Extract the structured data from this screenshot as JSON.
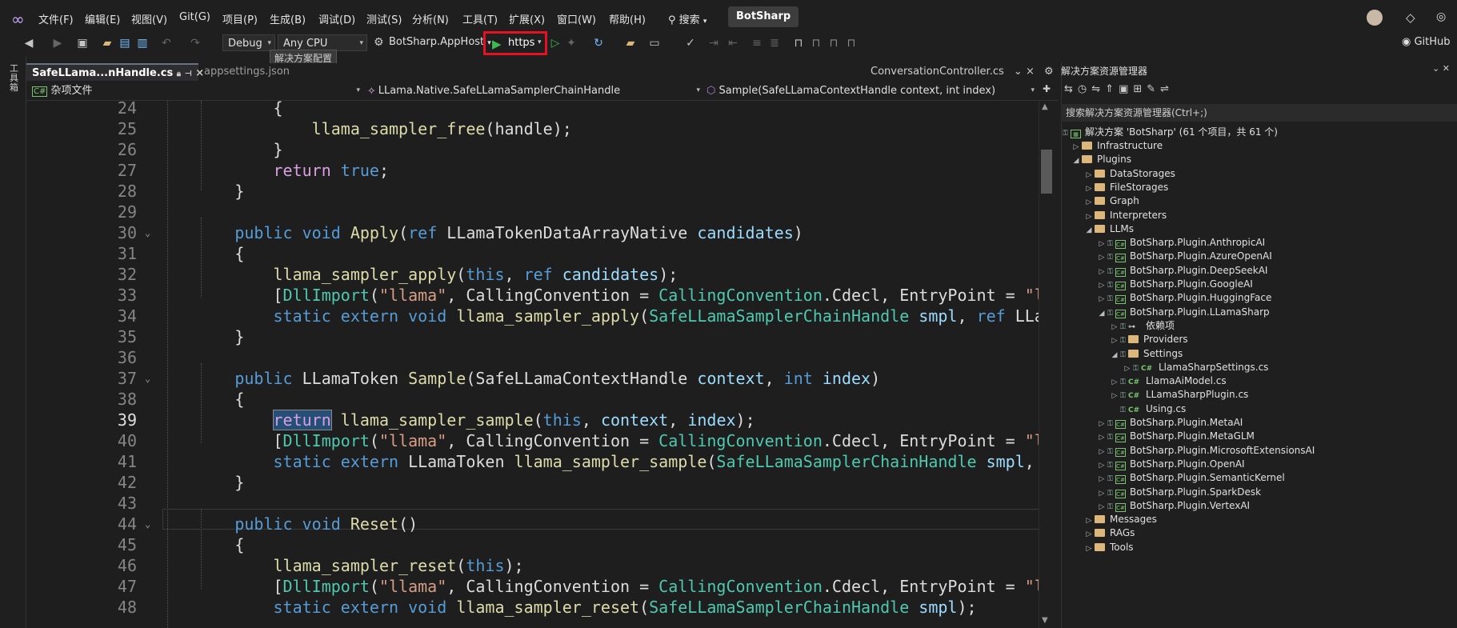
{
  "menu": {
    "items": [
      "文件(F)",
      "编辑(E)",
      "视图(V)",
      "Git(G)",
      "项目(P)",
      "生成(B)",
      "调试(D)",
      "测试(S)",
      "分析(N)",
      "工具(T)",
      "扩展(X)",
      "窗口(W)",
      "帮助(H)"
    ],
    "search_label": "搜索",
    "solution_name": "BotSharp",
    "github_label": "GitHub"
  },
  "toolbar": {
    "config": "Debug",
    "platform": "Any CPU",
    "startup_project": "BotSharp.AppHost",
    "run_profile": "https",
    "tooltip": "解决方案配置"
  },
  "left_strip": {
    "toolbox_label": "工具箱"
  },
  "tabs": {
    "active": "SafeLLama...nHandle.cs",
    "second": "appsettings.json",
    "right": "ConversationController.cs"
  },
  "navbar": {
    "project": "杂项文件",
    "type": "LLama.Native.SafeLLamaSamplerChainHandle",
    "member": "Sample(SafeLLamaContextHandle context, int index)"
  },
  "editor": {
    "current_line": 39,
    "lines": [
      {
        "n": "24",
        "tokens": [
          {
            "t": "            {",
            "c": "pl"
          }
        ]
      },
      {
        "n": "25",
        "tokens": [
          {
            "t": "                ",
            "c": "pl"
          },
          {
            "t": "llama_sampler_free",
            "c": "fn"
          },
          {
            "t": "(handle);",
            "c": "pl"
          }
        ]
      },
      {
        "n": "26",
        "tokens": [
          {
            "t": "            }",
            "c": "pl"
          }
        ]
      },
      {
        "n": "27",
        "tokens": [
          {
            "t": "            ",
            "c": "pl"
          },
          {
            "t": "return",
            "c": "ctl"
          },
          {
            "t": " ",
            "c": "pl"
          },
          {
            "t": "true",
            "c": "kw"
          },
          {
            "t": ";",
            "c": "pl"
          }
        ]
      },
      {
        "n": "28",
        "tokens": [
          {
            "t": "        }",
            "c": "pl"
          }
        ]
      },
      {
        "n": "29",
        "tokens": []
      },
      {
        "n": "30",
        "tokens": [
          {
            "t": "        ",
            "c": "pl"
          },
          {
            "t": "public",
            "c": "kw"
          },
          {
            "t": " ",
            "c": "pl"
          },
          {
            "t": "void",
            "c": "kw"
          },
          {
            "t": " ",
            "c": "pl"
          },
          {
            "t": "Apply",
            "c": "fn"
          },
          {
            "t": "(",
            "c": "pl"
          },
          {
            "t": "ref",
            "c": "kw"
          },
          {
            "t": " LLamaTokenDataArrayNative ",
            "c": "pl"
          },
          {
            "t": "candidates",
            "c": "prm"
          },
          {
            "t": ")",
            "c": "pl"
          }
        ]
      },
      {
        "n": "31",
        "tokens": [
          {
            "t": "        {",
            "c": "pl"
          }
        ]
      },
      {
        "n": "32",
        "tokens": [
          {
            "t": "            ",
            "c": "pl"
          },
          {
            "t": "llama_sampler_apply",
            "c": "fn"
          },
          {
            "t": "(",
            "c": "pl"
          },
          {
            "t": "this",
            "c": "kw"
          },
          {
            "t": ", ",
            "c": "pl"
          },
          {
            "t": "ref",
            "c": "kw"
          },
          {
            "t": " ",
            "c": "pl"
          },
          {
            "t": "candidates",
            "c": "prm"
          },
          {
            "t": ");",
            "c": "pl"
          }
        ]
      },
      {
        "n": "33",
        "tokens": [
          {
            "t": "            [",
            "c": "pl"
          },
          {
            "t": "DllImport",
            "c": "ty"
          },
          {
            "t": "(",
            "c": "pl"
          },
          {
            "t": "\"llama\"",
            "c": "str"
          },
          {
            "t": ", CallingConvention = ",
            "c": "pl"
          },
          {
            "t": "CallingConvention",
            "c": "ty"
          },
          {
            "t": ".",
            "c": "pl"
          },
          {
            "t": "Cdecl",
            "c": "pl"
          },
          {
            "t": ", EntryPoint = ",
            "c": "pl"
          },
          {
            "t": "\"llam",
            "c": "str"
          }
        ]
      },
      {
        "n": "34",
        "tokens": [
          {
            "t": "            ",
            "c": "pl"
          },
          {
            "t": "static",
            "c": "kw"
          },
          {
            "t": " ",
            "c": "pl"
          },
          {
            "t": "extern",
            "c": "kw"
          },
          {
            "t": " ",
            "c": "pl"
          },
          {
            "t": "void",
            "c": "kw"
          },
          {
            "t": " ",
            "c": "pl"
          },
          {
            "t": "llama_sampler_apply",
            "c": "fn"
          },
          {
            "t": "(",
            "c": "pl"
          },
          {
            "t": "SafeLLamaSamplerChainHandle",
            "c": "ty"
          },
          {
            "t": " ",
            "c": "pl"
          },
          {
            "t": "smpl",
            "c": "prm"
          },
          {
            "t": ", ",
            "c": "pl"
          },
          {
            "t": "ref",
            "c": "kw"
          },
          {
            "t": " LLamaT",
            "c": "pl"
          }
        ]
      },
      {
        "n": "35",
        "tokens": [
          {
            "t": "        }",
            "c": "pl"
          }
        ]
      },
      {
        "n": "36",
        "tokens": []
      },
      {
        "n": "37",
        "tokens": [
          {
            "t": "        ",
            "c": "pl"
          },
          {
            "t": "public",
            "c": "kw"
          },
          {
            "t": " LLamaToken ",
            "c": "pl"
          },
          {
            "t": "Sample",
            "c": "fn"
          },
          {
            "t": "(SafeLLamaContextHandle ",
            "c": "pl"
          },
          {
            "t": "context",
            "c": "prm"
          },
          {
            "t": ", ",
            "c": "pl"
          },
          {
            "t": "int",
            "c": "kw"
          },
          {
            "t": " ",
            "c": "pl"
          },
          {
            "t": "index",
            "c": "prm"
          },
          {
            "t": ")",
            "c": "pl"
          }
        ]
      },
      {
        "n": "38",
        "tokens": [
          {
            "t": "        {",
            "c": "pl"
          }
        ]
      },
      {
        "n": "39",
        "tokens": [
          {
            "t": "            ",
            "c": "pl"
          },
          {
            "t": "return",
            "c": "ctl"
          },
          {
            "t": " ",
            "c": "pl"
          },
          {
            "t": "llama_sampler_sample",
            "c": "fn"
          },
          {
            "t": "(",
            "c": "pl"
          },
          {
            "t": "this",
            "c": "kw"
          },
          {
            "t": ", ",
            "c": "pl"
          },
          {
            "t": "context",
            "c": "prm"
          },
          {
            "t": ", ",
            "c": "pl"
          },
          {
            "t": "index",
            "c": "prm"
          },
          {
            "t": ");",
            "c": "pl"
          }
        ]
      },
      {
        "n": "40",
        "tokens": [
          {
            "t": "            [",
            "c": "pl"
          },
          {
            "t": "DllImport",
            "c": "ty"
          },
          {
            "t": "(",
            "c": "pl"
          },
          {
            "t": "\"llama\"",
            "c": "str"
          },
          {
            "t": ", CallingConvention = ",
            "c": "pl"
          },
          {
            "t": "CallingConvention",
            "c": "ty"
          },
          {
            "t": ".",
            "c": "pl"
          },
          {
            "t": "Cdecl",
            "c": "pl"
          },
          {
            "t": ", EntryPoint = ",
            "c": "pl"
          },
          {
            "t": "\"llam",
            "c": "str"
          }
        ]
      },
      {
        "n": "41",
        "tokens": [
          {
            "t": "            ",
            "c": "pl"
          },
          {
            "t": "static",
            "c": "kw"
          },
          {
            "t": " ",
            "c": "pl"
          },
          {
            "t": "extern",
            "c": "kw"
          },
          {
            "t": " LLamaToken ",
            "c": "pl"
          },
          {
            "t": "llama_sampler_sample",
            "c": "fn"
          },
          {
            "t": "(",
            "c": "pl"
          },
          {
            "t": "SafeLLamaSamplerChainHandle",
            "c": "ty"
          },
          {
            "t": " ",
            "c": "pl"
          },
          {
            "t": "smpl",
            "c": "prm"
          },
          {
            "t": ", Saf",
            "c": "pl"
          }
        ]
      },
      {
        "n": "42",
        "tokens": [
          {
            "t": "        }",
            "c": "pl"
          }
        ]
      },
      {
        "n": "43",
        "tokens": []
      },
      {
        "n": "44",
        "tokens": [
          {
            "t": "        ",
            "c": "pl"
          },
          {
            "t": "public",
            "c": "kw"
          },
          {
            "t": " ",
            "c": "pl"
          },
          {
            "t": "void",
            "c": "kw"
          },
          {
            "t": " ",
            "c": "pl"
          },
          {
            "t": "Reset",
            "c": "fn"
          },
          {
            "t": "()",
            "c": "pl"
          }
        ]
      },
      {
        "n": "45",
        "tokens": [
          {
            "t": "        {",
            "c": "pl"
          }
        ]
      },
      {
        "n": "46",
        "tokens": [
          {
            "t": "            ",
            "c": "pl"
          },
          {
            "t": "llama_sampler_reset",
            "c": "fn"
          },
          {
            "t": "(",
            "c": "pl"
          },
          {
            "t": "this",
            "c": "kw"
          },
          {
            "t": ");",
            "c": "pl"
          }
        ]
      },
      {
        "n": "47",
        "tokens": [
          {
            "t": "            [",
            "c": "pl"
          },
          {
            "t": "DllImport",
            "c": "ty"
          },
          {
            "t": "(",
            "c": "pl"
          },
          {
            "t": "\"llama\"",
            "c": "str"
          },
          {
            "t": ", CallingConvention = ",
            "c": "pl"
          },
          {
            "t": "CallingConvention",
            "c": "ty"
          },
          {
            "t": ".",
            "c": "pl"
          },
          {
            "t": "Cdecl",
            "c": "pl"
          },
          {
            "t": ", EntryPoint = ",
            "c": "pl"
          },
          {
            "t": "\"llam",
            "c": "str"
          }
        ]
      },
      {
        "n": "48",
        "tokens": [
          {
            "t": "            ",
            "c": "pl"
          },
          {
            "t": "static",
            "c": "kw"
          },
          {
            "t": " ",
            "c": "pl"
          },
          {
            "t": "extern",
            "c": "kw"
          },
          {
            "t": " ",
            "c": "pl"
          },
          {
            "t": "void",
            "c": "kw"
          },
          {
            "t": " ",
            "c": "pl"
          },
          {
            "t": "llama_sampler_reset",
            "c": "fn"
          },
          {
            "t": "(",
            "c": "pl"
          },
          {
            "t": "SafeLLamaSamplerChainHandle",
            "c": "ty"
          },
          {
            "t": " ",
            "c": "pl"
          },
          {
            "t": "smpl",
            "c": "prm"
          },
          {
            "t": ");",
            "c": "pl"
          }
        ]
      }
    ]
  },
  "solution_explorer": {
    "title": "解决方案资源管理器",
    "search_placeholder": "搜索解决方案资源管理器(Ctrl+;)",
    "solution_label": "解决方案 'BotSharp' (61 个项目，共 61 个)",
    "items": [
      {
        "label": "Infrastructure",
        "kind": "folder",
        "depth": 0,
        "tw": "▷"
      },
      {
        "label": "Plugins",
        "kind": "folder",
        "depth": 0,
        "tw": "◢"
      },
      {
        "label": "DataStorages",
        "kind": "folder",
        "depth": 1,
        "tw": "▷"
      },
      {
        "label": "FileStorages",
        "kind": "folder",
        "depth": 1,
        "tw": "▷"
      },
      {
        "label": "Graph",
        "kind": "folder",
        "depth": 1,
        "tw": "▷"
      },
      {
        "label": "Interpreters",
        "kind": "folder",
        "depth": 1,
        "tw": "▷"
      },
      {
        "label": "LLMs",
        "kind": "folder",
        "depth": 1,
        "tw": "◢"
      },
      {
        "label": "BotSharp.Plugin.AnthropicAI",
        "kind": "project",
        "depth": 2,
        "tw": "▷"
      },
      {
        "label": "BotSharp.Plugin.AzureOpenAI",
        "kind": "project",
        "depth": 2,
        "tw": "▷"
      },
      {
        "label": "BotSharp.Plugin.DeepSeekAI",
        "kind": "project",
        "depth": 2,
        "tw": "▷"
      },
      {
        "label": "BotSharp.Plugin.GoogleAI",
        "kind": "project",
        "depth": 2,
        "tw": "▷"
      },
      {
        "label": "BotSharp.Plugin.HuggingFace",
        "kind": "project",
        "depth": 2,
        "tw": "▷"
      },
      {
        "label": "BotSharp.Plugin.LLamaSharp",
        "kind": "project",
        "depth": 2,
        "tw": "◢"
      },
      {
        "label": "依赖项",
        "kind": "deps",
        "depth": 3,
        "tw": "▷"
      },
      {
        "label": "Providers",
        "kind": "folder",
        "depth": 3,
        "tw": "▷"
      },
      {
        "label": "Settings",
        "kind": "folder",
        "depth": 3,
        "tw": "◢"
      },
      {
        "label": "LlamaSharpSettings.cs",
        "kind": "cs",
        "depth": 4,
        "tw": "▷"
      },
      {
        "label": "LlamaAiModel.cs",
        "kind": "cs",
        "depth": 3,
        "tw": "▷"
      },
      {
        "label": "LLamaSharpPlugin.cs",
        "kind": "cs",
        "depth": 3,
        "tw": "▷"
      },
      {
        "label": "Using.cs",
        "kind": "cs",
        "depth": 3,
        "tw": ""
      },
      {
        "label": "BotSharp.Plugin.MetaAI",
        "kind": "project",
        "depth": 2,
        "tw": "▷"
      },
      {
        "label": "BotSharp.Plugin.MetaGLM",
        "kind": "project",
        "depth": 2,
        "tw": "▷"
      },
      {
        "label": "BotSharp.Plugin.MicrosoftExtensionsAI",
        "kind": "project",
        "depth": 2,
        "tw": "▷"
      },
      {
        "label": "BotSharp.Plugin.OpenAI",
        "kind": "project",
        "depth": 2,
        "tw": "▷"
      },
      {
        "label": "BotSharp.Plugin.SemanticKernel",
        "kind": "project",
        "depth": 2,
        "tw": "▷"
      },
      {
        "label": "BotSharp.Plugin.SparkDesk",
        "kind": "project",
        "depth": 2,
        "tw": "▷"
      },
      {
        "label": "BotSharp.Plugin.VertexAI",
        "kind": "project",
        "depth": 2,
        "tw": "▷"
      },
      {
        "label": "Messages",
        "kind": "folder",
        "depth": 1,
        "tw": "▷"
      },
      {
        "label": "RAGs",
        "kind": "folder",
        "depth": 1,
        "tw": "▷"
      },
      {
        "label": "Tools",
        "kind": "folder",
        "depth": 1,
        "tw": "▷"
      }
    ]
  }
}
